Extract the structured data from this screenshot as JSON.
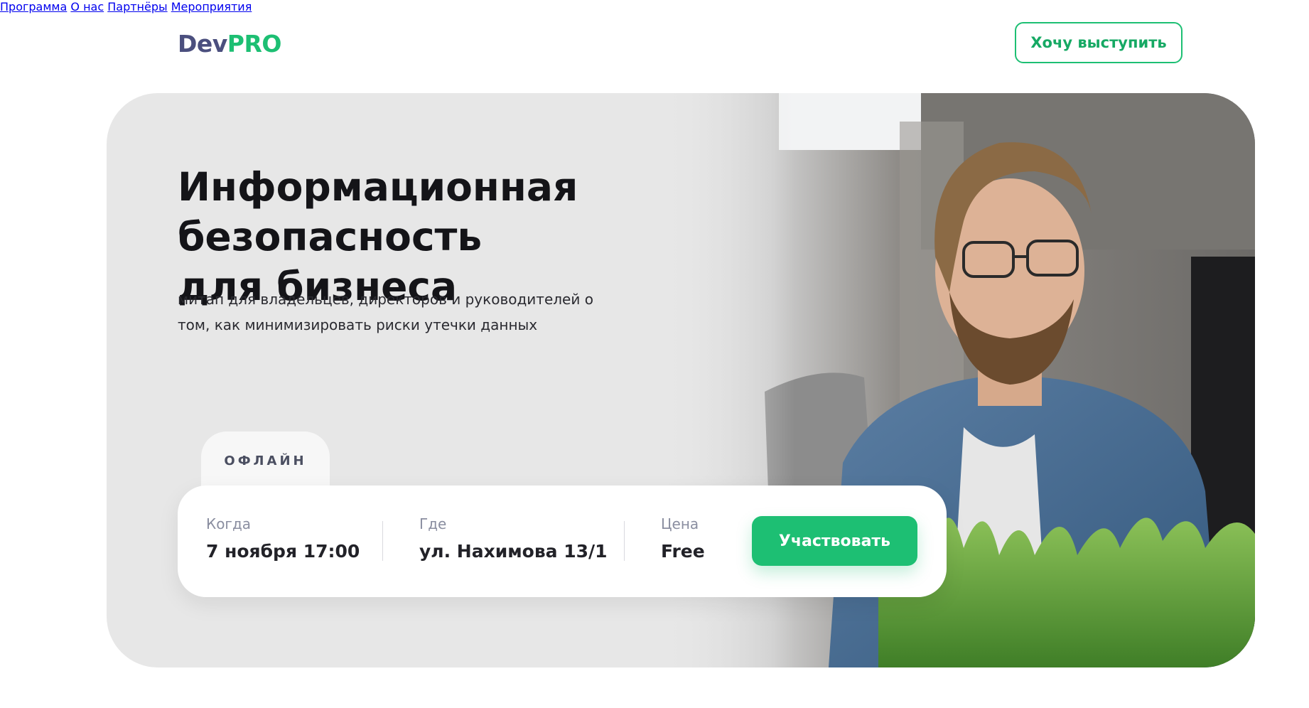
{
  "header": {
    "logo_dev": "Dev",
    "logo_pro": "PRO",
    "nav": [
      "Программа",
      "О нас",
      "Партнёры",
      "Мероприятия"
    ],
    "cta": "Хочу выступить"
  },
  "hero": {
    "title_line1": "Информационная безопасность",
    "title_line2": "для бизнеса",
    "subtitle_line1": "митап для владельцев, директоров и руководителей о",
    "subtitle_line2": "том, как минимизировать риски утечки данных",
    "format_tab": "ОФЛАЙН",
    "when_label": "Когда",
    "when_value": "7 ноября 17:00",
    "where_label": "Где",
    "where_value": "ул. Нахимова 13/1",
    "price_label": "Цена",
    "price_value": "Free",
    "join_button": "Участвовать"
  },
  "colors": {
    "accent": "#1dbf73",
    "logo_dark": "#4b4f7e"
  },
  "icons": []
}
